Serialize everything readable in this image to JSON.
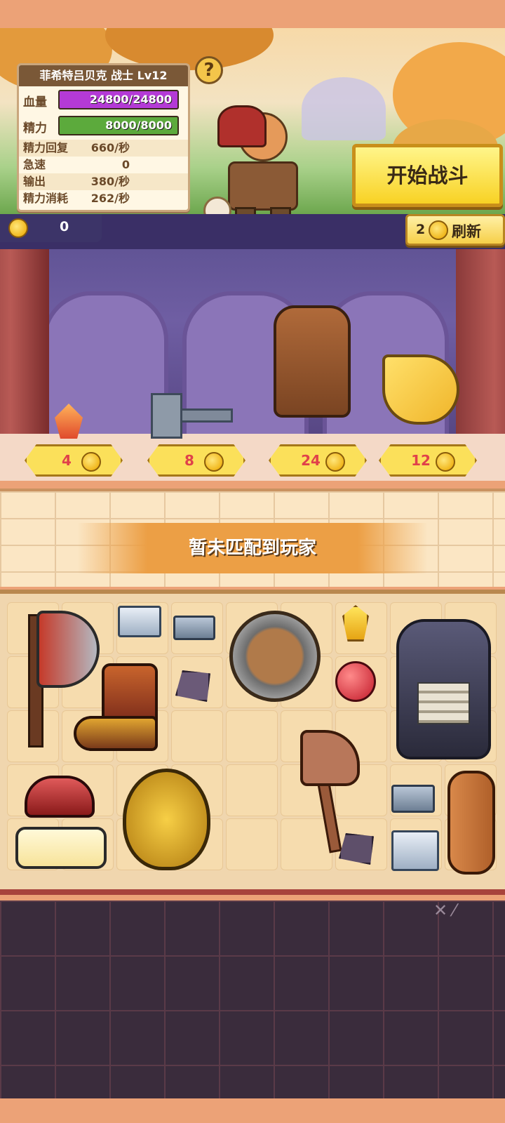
{
  "hero": {
    "name_line": "菲希特吕贝克 战士 Lv12",
    "hp_label": "血量",
    "hp_value": "24800/24800",
    "hp_fraction": 1.0,
    "energy_label": "精力",
    "energy_value": "8000/8000",
    "energy_fraction": 1.0,
    "stats": [
      {
        "label": "精力回复",
        "value": "660/秒"
      },
      {
        "label": "急速",
        "value": "0"
      },
      {
        "label": "输出",
        "value": "380/秒"
      },
      {
        "label": "精力消耗",
        "value": "262/秒"
      }
    ],
    "help_symbol": "?"
  },
  "actions": {
    "start_battle": "开始战斗"
  },
  "shop": {
    "gold": "0",
    "refresh_cost": "2",
    "refresh_label": "刷新",
    "items": [
      {
        "name": "crystal-shard-icon",
        "price": "4"
      },
      {
        "name": "hammer-icon",
        "price": "8"
      },
      {
        "name": "leather-armor-icon",
        "price": "24"
      },
      {
        "name": "banana-icon",
        "price": "12"
      }
    ]
  },
  "match": {
    "status": "暂未匹配到玩家"
  },
  "colors": {
    "hp_bar": "#b43ad6",
    "energy_bar": "#5caa3c",
    "price_text": "#e0414a",
    "accent_gold": "#f6cf48"
  }
}
